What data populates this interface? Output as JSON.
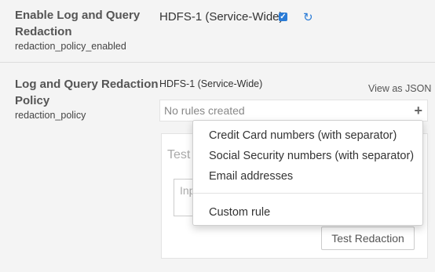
{
  "properties": [
    {
      "title_line1": "Enable Log and Query",
      "title_line2": "Redaction",
      "key": "redaction_policy_enabled",
      "scope": "HDFS-1 (Service-Wide)",
      "checked": true
    },
    {
      "title_line1": "Log and Query Redaction",
      "title_line2": "Policy",
      "key": "redaction_policy",
      "scope": "HDFS-1 (Service-Wide)",
      "view_json_label": "View as JSON",
      "rules_text": "No rules created"
    }
  ],
  "icons": {
    "checkbox_checkmark": "✓",
    "revert": "↻",
    "add_rule": "+"
  },
  "test_panel": {
    "title": "Test",
    "input_placeholder": "Inp",
    "button_label": "Test Redaction"
  },
  "dropdown": {
    "items": [
      "Credit Card numbers (with separator)",
      "Social Security numbers (with separator)",
      "Email addresses"
    ],
    "custom_label": "Custom rule"
  },
  "colors": {
    "accent": "#2a7bd6",
    "background": "#f4f4f4"
  }
}
